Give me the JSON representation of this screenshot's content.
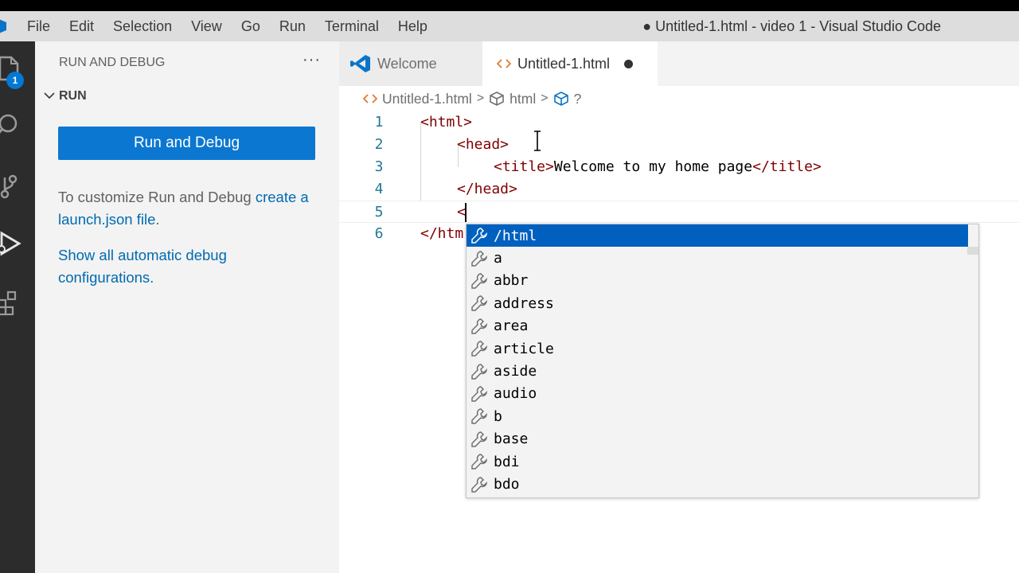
{
  "menu": [
    "File",
    "Edit",
    "Selection",
    "View",
    "Go",
    "Run",
    "Terminal",
    "Help"
  ],
  "window_title": "● Untitled-1.html - video 1 - Visual Studio Code",
  "activity_bar": {
    "explorer_badge": "1",
    "icons": [
      "files-icon",
      "search-icon",
      "source-control-icon",
      "run-debug-icon",
      "extensions-icon"
    ]
  },
  "sidebar": {
    "header": "RUN AND DEBUG",
    "more": "···",
    "section": "RUN",
    "run_button": "Run and Debug",
    "customize_text": "To customize Run and Debug ",
    "create_link": "create a launch.json file",
    "period": ".",
    "show_all_link": "Show all automatic debug configurations."
  },
  "tabs": [
    {
      "label": "Welcome",
      "icon": "vscode-logo-icon"
    },
    {
      "label": "Untitled-1.html",
      "icon": "html-file-icon",
      "dirty": true
    }
  ],
  "breadcrumb": [
    "Untitled-1.html",
    "html",
    "?"
  ],
  "code": {
    "line_numbers": [
      "1",
      "2",
      "3",
      "4",
      "5",
      "6"
    ],
    "lines": [
      {
        "tag_open": "<html>"
      },
      {
        "tag_open": "<head>"
      },
      {
        "tag_open": "<title>",
        "text": "Welcome to my home page",
        "tag_close": "</title>"
      },
      {
        "tag_open": "</head>"
      },
      {
        "tag_open": "<"
      },
      {
        "tag_open": "</htm"
      }
    ]
  },
  "suggestions": [
    "/html",
    "a",
    "abbr",
    "address",
    "area",
    "article",
    "aside",
    "audio",
    "b",
    "base",
    "bdi",
    "bdo"
  ],
  "colors": {
    "accent": "#0078d4",
    "selected_suggestion": "#0060c0",
    "tag": "#800000",
    "line_number": "#237893"
  }
}
